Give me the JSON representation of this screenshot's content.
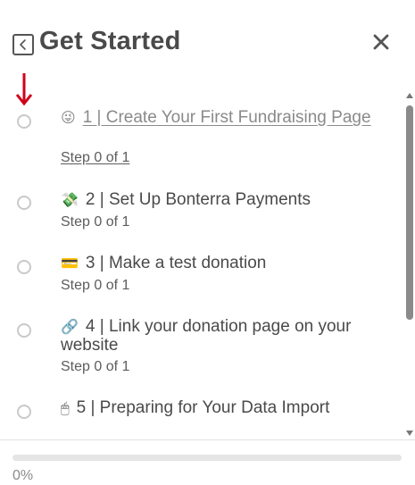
{
  "header": {
    "title": "Get Started",
    "back_icon": "chevron-left-icon",
    "close_icon": "close-icon"
  },
  "items": [
    {
      "emoji": "😜",
      "title": "1 | Create Your First Fundraising Page",
      "step": "Step 0 of 1",
      "is_link": true
    },
    {
      "emoji": "💸",
      "title": "2 | Set Up Bonterra Payments",
      "step": "Step 0 of 1",
      "is_link": false
    },
    {
      "emoji": "💳",
      "title": "3 | Make a test donation",
      "step": "Step 0 of 1",
      "is_link": false
    },
    {
      "emoji": "🔗",
      "title": "4 | Link your donation page on your website",
      "step": "Step 0 of 1",
      "is_link": false
    },
    {
      "emoji": "🖱",
      "title": "5 | Preparing for Your Data Import",
      "step": "",
      "is_link": false
    }
  ],
  "progress": {
    "percent_text": "0%",
    "value": 0
  },
  "colors": {
    "arrow": "#d0021b",
    "text": "#4a4a4a",
    "progress_track": "#e5e5e5"
  }
}
